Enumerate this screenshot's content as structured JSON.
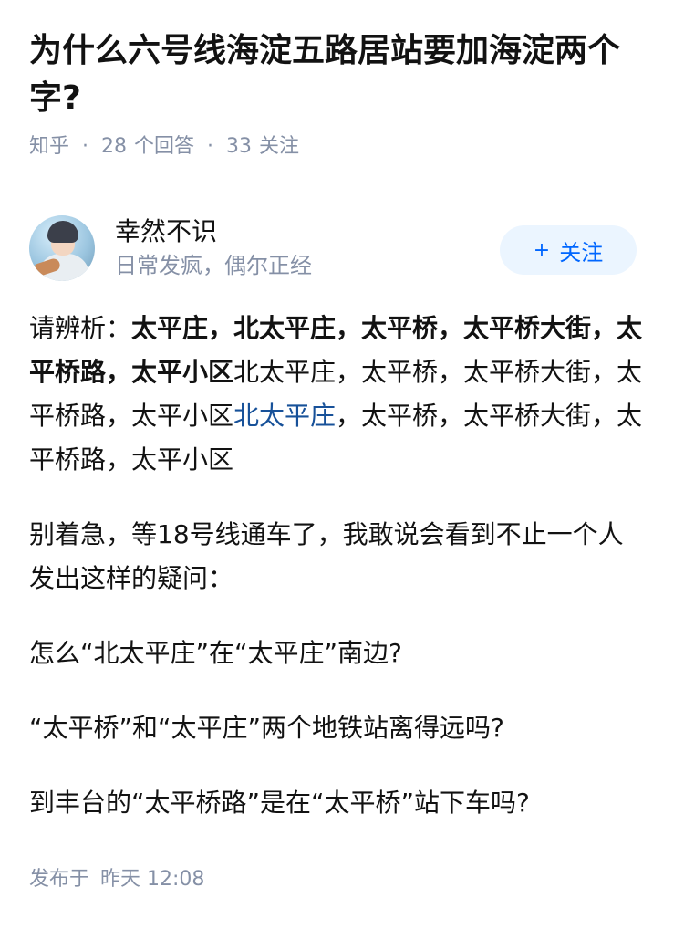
{
  "question": {
    "title": "为什么六号线海淀五路居站要加海淀两个字?",
    "source": "知乎",
    "answers_count": "28",
    "answers_label": "个回答",
    "followers_count": "33",
    "followers_label": "关注"
  },
  "author": {
    "name": "幸然不识",
    "bio": "日常发疯，偶尔正经",
    "avatar_icon": "avatar-illustration-icon"
  },
  "follow_button": {
    "icon": "plus-icon",
    "icon_glyph": "+",
    "label": "关注"
  },
  "answer": {
    "p1_prefix": "请辨析：",
    "p1_bold": "太平庄，北太平庄，太平桥，太平桥大街，太平桥路，太平小区",
    "p1_plain": "北太平庄，太平桥，太平桥大街，太平桥路，太平小区",
    "p1_link": "北太平庄",
    "p1_tail": "，太平桥，太平桥大街，太平桥路，太平小区",
    "p2": "别着急，等18号线通车了，我敢说会看到不止一个人发出这样的疑问：",
    "p3": "怎么“北太平庄”在“太平庄”南边?",
    "p4": "“太平桥”和“太平庄”两个地铁站离得远吗?",
    "p5": "到丰台的“太平桥路”是在“太平桥”站下车吗?"
  },
  "footer": {
    "published_label": "发布于",
    "published_time": "昨天 12:08"
  },
  "colors": {
    "title": "#121212",
    "meta": "#8590a6",
    "link": "#175199",
    "follow_bg": "#ebf5ff",
    "follow_text": "#0066ff"
  }
}
